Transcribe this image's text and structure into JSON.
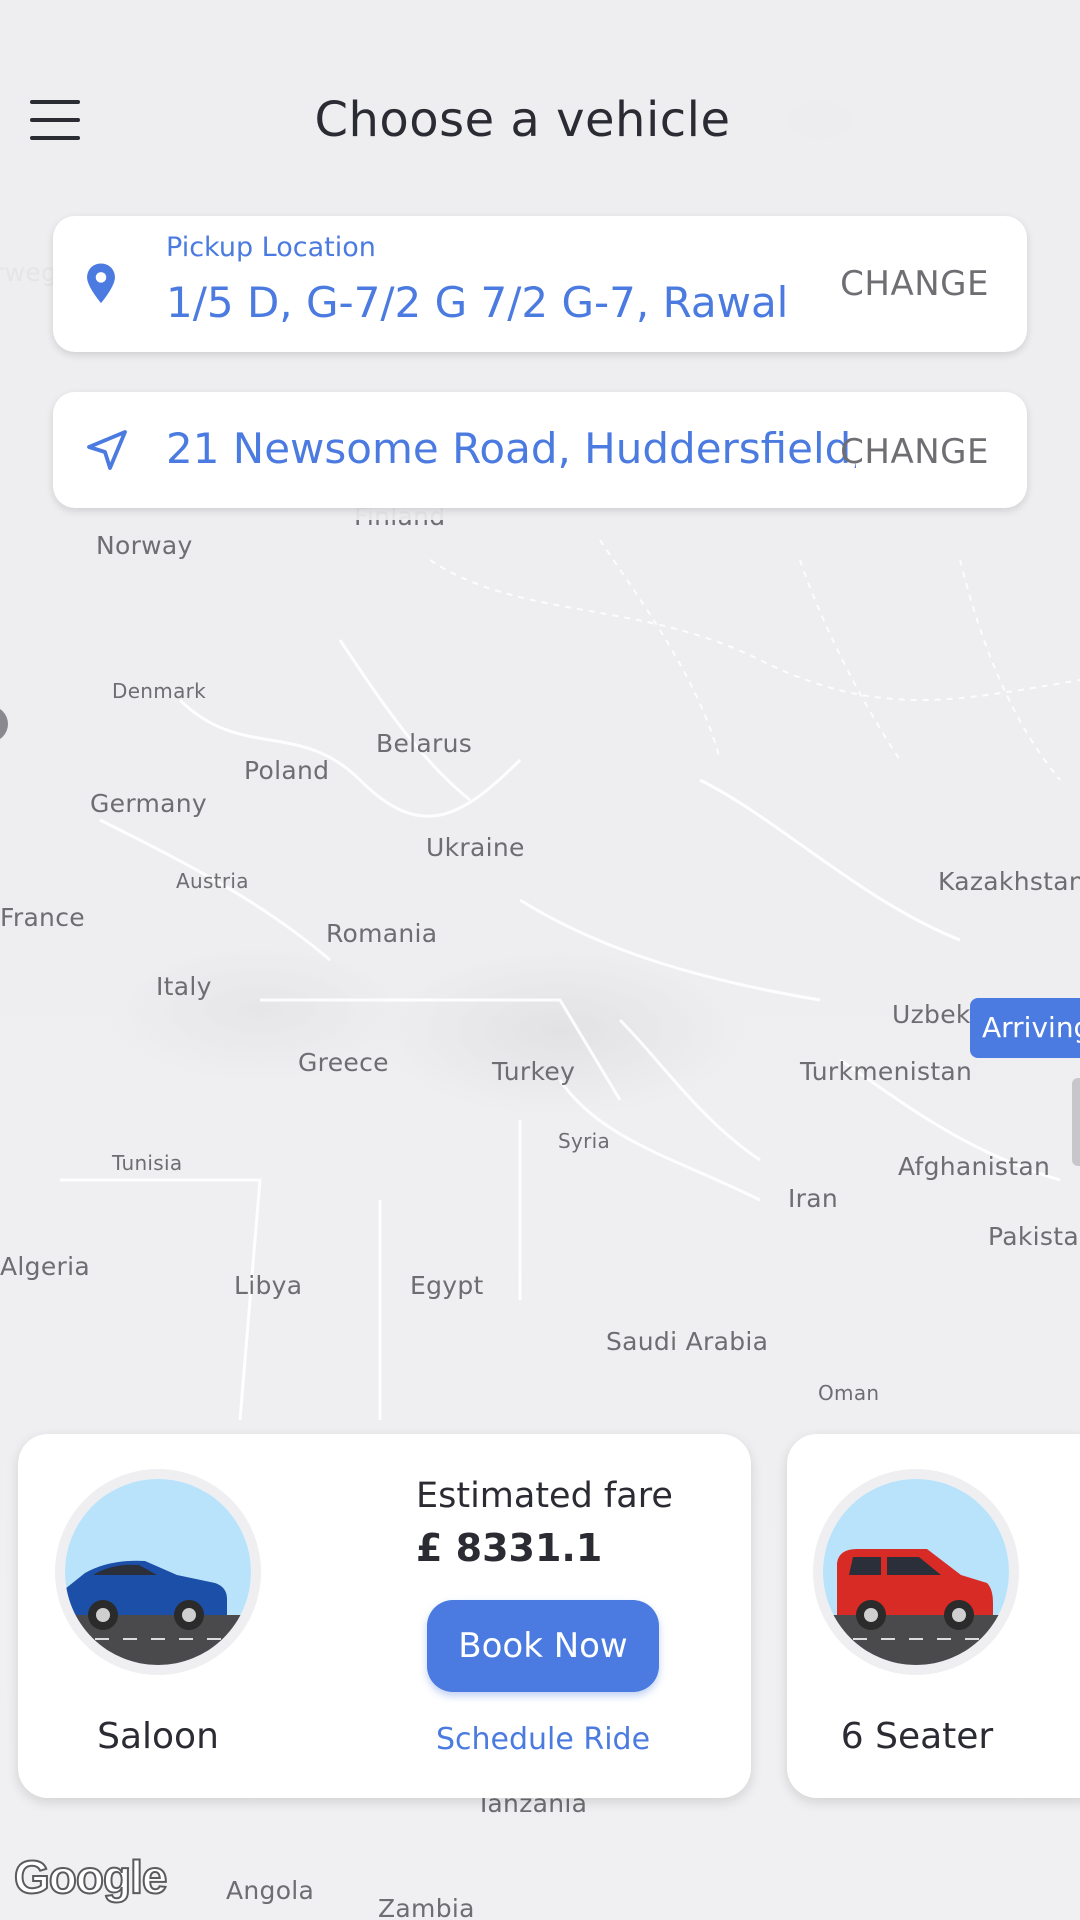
{
  "header": {
    "title": "Choose a vehicle",
    "menu_icon": "hamburger-menu-icon"
  },
  "pickup": {
    "label": "Pickup Location",
    "address": "1/5 D, G-7/2 G 7/2 G-7, Rawal",
    "change_label": "CHANGE",
    "icon": "location-pin-icon"
  },
  "dropoff": {
    "address": "21 Newsome Road, Huddersfield,",
    "change_label": "CHANGE",
    "icon": "navigation-arrow-icon"
  },
  "map": {
    "labels": {
      "norway_cut": "rweg",
      "finland": "Finland",
      "norway": "Norway",
      "denmark": "Denmark",
      "belarus": "Belarus",
      "poland": "Poland",
      "germany": "Germany",
      "ukraine": "Ukraine",
      "austria": "Austria",
      "kazakhstan": "Kazakhstan",
      "france": "France",
      "romania": "Romania",
      "italy": "Italy",
      "uzbekistan": "Uzbeki",
      "greece": "Greece",
      "turkey": "Turkey",
      "turkmenistan": "Turkmenistan",
      "syria": "Syria",
      "tunisia": "Tunisia",
      "afghanistan": "Afghanistan",
      "iran": "Iran",
      "pakistan": "Pakista",
      "algeria": "Algeria",
      "libya": "Libya",
      "egypt": "Egypt",
      "saudi_arabia": "Saudi Arabia",
      "oman": "Oman",
      "tanzania": "Tanzania",
      "angola": "Angola",
      "zambia": "Zambia"
    },
    "arriving_label": "Arriving",
    "attribution": "Google"
  },
  "vehicles": [
    {
      "name": "Saloon",
      "fare_label": "Estimated fare",
      "fare_value": "£ 8331.1",
      "book_label": "Book Now",
      "schedule_label": "Schedule Ride",
      "car_color": "#1b4fa8"
    },
    {
      "name": "6 Seater",
      "car_color": "#d92b25"
    }
  ],
  "colors": {
    "accent": "#4b7be0",
    "text": "#2b2b33",
    "muted": "#6e6e73"
  }
}
